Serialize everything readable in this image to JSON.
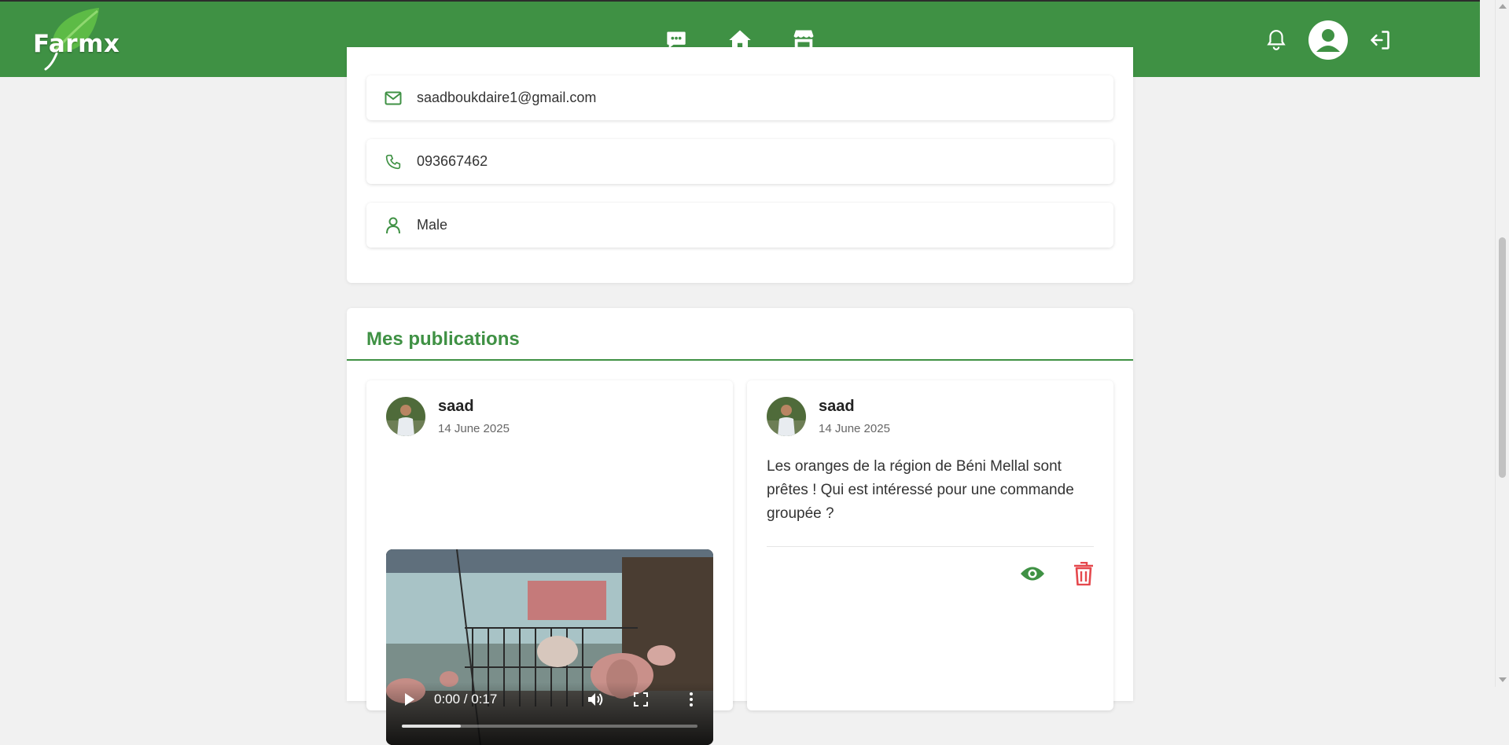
{
  "colors": {
    "brand_green": "#3f9144",
    "danger_red": "#e5484d",
    "page_bg": "#f1f1f1"
  },
  "navbar": {
    "logo_text": "Farmx",
    "center_icons": [
      "chat-bubble-icon",
      "home-icon",
      "store-icon"
    ],
    "right_icons": [
      "bell-icon",
      "user-avatar-icon",
      "logout-icon"
    ]
  },
  "profile": {
    "email": "saadboukdaire1@gmail.com",
    "phone": "093667462",
    "gender": "Male"
  },
  "publications": {
    "title": "Mes publications",
    "posts": [
      {
        "author": "saad",
        "date": "14 June 2025",
        "media": "video",
        "video_time": "0:00 / 0:17",
        "video_progress": 0.2
      },
      {
        "author": "saad",
        "date": "14 June 2025",
        "text": "Les oranges de la région de Béni Mellal sont prêtes ! Qui est intéressé pour une commande groupée ?",
        "actions": [
          "eye-icon",
          "trash-icon"
        ]
      }
    ]
  }
}
